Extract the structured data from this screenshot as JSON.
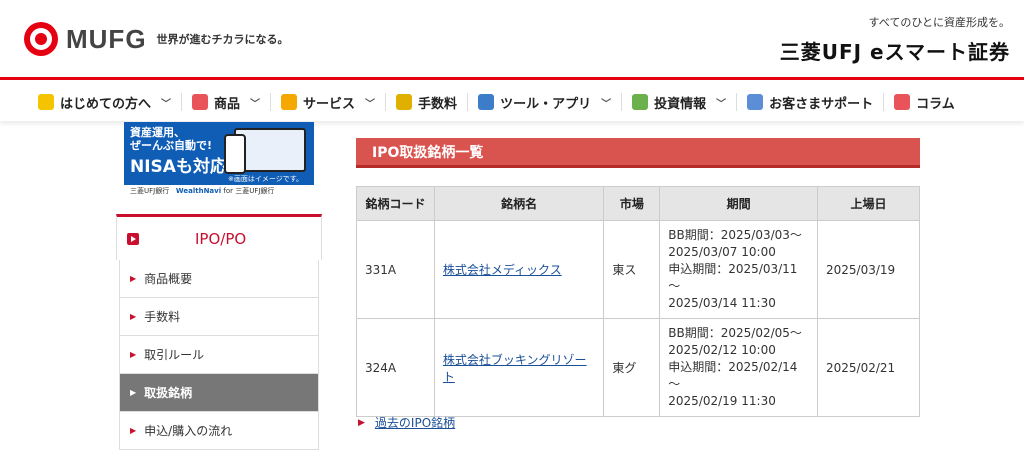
{
  "header": {
    "logo_text": "MUFG",
    "logo_tagline": "世界が進むチカラになる。",
    "brand_tagline": "すべてのひとに資産形成を。",
    "brand_name": "三菱UFJ eスマート証券"
  },
  "nav": [
    {
      "label": "はじめての方へ",
      "icon": "beginner-icon",
      "color": "#f5c400",
      "dropdown": true
    },
    {
      "label": "商品",
      "icon": "bag-icon",
      "color": "#e8545a",
      "dropdown": true
    },
    {
      "label": "サービス",
      "icon": "star-icon",
      "color": "#f5a800",
      "dropdown": true
    },
    {
      "label": "手数料",
      "icon": "coin-icon",
      "color": "#e0b000",
      "dropdown": false
    },
    {
      "label": "ツール・アプリ",
      "icon": "monitor-icon",
      "color": "#3d7cc9",
      "dropdown": true
    },
    {
      "label": "投資情報",
      "icon": "chart-icon",
      "color": "#6ab04c",
      "dropdown": true
    },
    {
      "label": "お客さまサポート",
      "icon": "support-icon",
      "color": "#5b8ed6",
      "dropdown": false
    },
    {
      "label": "コラム",
      "icon": "book-icon",
      "color": "#e8545a",
      "dropdown": false
    }
  ],
  "banner": {
    "line1": "資産運用、",
    "line2": "ぜーんぶ自動で!",
    "line3": "NISAも対応",
    "note": "※画面はイメージです。",
    "footer_bank": "三菱UFJ銀行",
    "footer_service": "WealthNavi",
    "footer_for": "for 三菱UFJ銀行"
  },
  "sidebar": {
    "title": "IPO/PO",
    "items": [
      {
        "label": "商品概要",
        "active": false
      },
      {
        "label": "手数料",
        "active": false
      },
      {
        "label": "取引ルール",
        "active": false
      },
      {
        "label": "取扱銘柄",
        "active": true
      },
      {
        "label": "申込/購入の流れ",
        "active": false
      }
    ]
  },
  "main": {
    "title": "IPO取扱銘柄一覧",
    "table": {
      "headers": [
        "銘柄コード",
        "銘柄名",
        "市場",
        "期間",
        "上場日"
      ],
      "rows": [
        {
          "code": "331A",
          "name": "株式会社メディックス",
          "market": "東ス",
          "period_lines": [
            "BB期間：2025/03/03～",
            "2025/03/07 10:00",
            "申込期間：2025/03/11～",
            "2025/03/14 11:30"
          ],
          "listing_date": "2025/03/19"
        },
        {
          "code": "324A",
          "name": "株式会社ブッキングリゾート",
          "market": "東グ",
          "period_lines": [
            "BB期間：2025/02/05～",
            "2025/02/12 10:00",
            "申込期間：2025/02/14～",
            "2025/02/19 11:30"
          ],
          "listing_date": "2025/02/21"
        }
      ]
    },
    "past_link": "過去のIPO銘柄"
  }
}
